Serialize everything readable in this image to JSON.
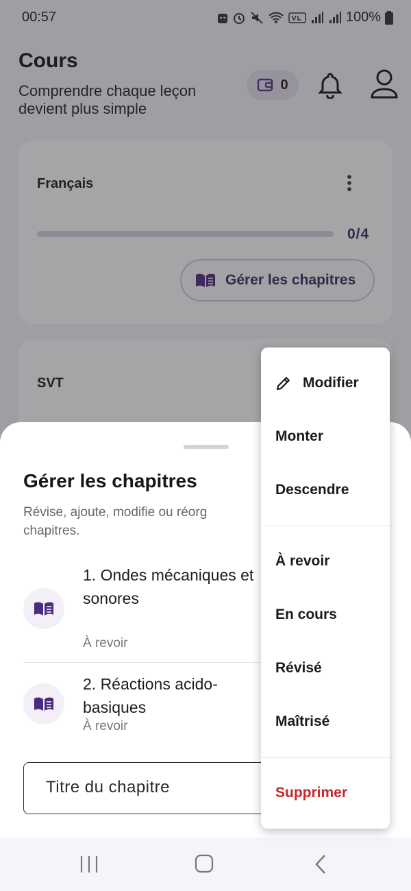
{
  "status_bar": {
    "time": "00:57",
    "battery": "100%",
    "icons": [
      "face-icon",
      "alarm-icon",
      "mute-icon",
      "wifi-icon",
      "volte-icon",
      "signal-icon",
      "signal2-icon",
      "battery-icon"
    ]
  },
  "header": {
    "title": "Cours",
    "subtitle": "Comprendre chaque leçon devient plus simple",
    "coins": "0"
  },
  "subjects": [
    {
      "name": "Français",
      "progress_text": "0/4",
      "progress": 0,
      "manage_label": "Gérer les chapitres"
    },
    {
      "name": "SVT"
    }
  ],
  "sheet": {
    "title": "Gérer les chapitres",
    "subtitle_line1": "Révise, ajoute, modifie ou réorg",
    "subtitle_line2": "chapitres.",
    "chapters": [
      {
        "title": "1. Ondes mécaniques et sonores",
        "status": "À revoir"
      },
      {
        "title": "2. Réactions acido-basiques",
        "status": "À revoir"
      }
    ],
    "input_placeholder": "Titre du chapitre"
  },
  "menu": {
    "edit": "Modifier",
    "move_up": "Monter",
    "move_down": "Descendre",
    "to_review": "À revoir",
    "in_progress": "En cours",
    "revised": "Révisé",
    "mastered": "Maîtrisé",
    "delete": "Supprimer"
  },
  "colors": {
    "accent": "#5b2f86",
    "delete": "#c8262c",
    "scrim": "#28282e"
  }
}
